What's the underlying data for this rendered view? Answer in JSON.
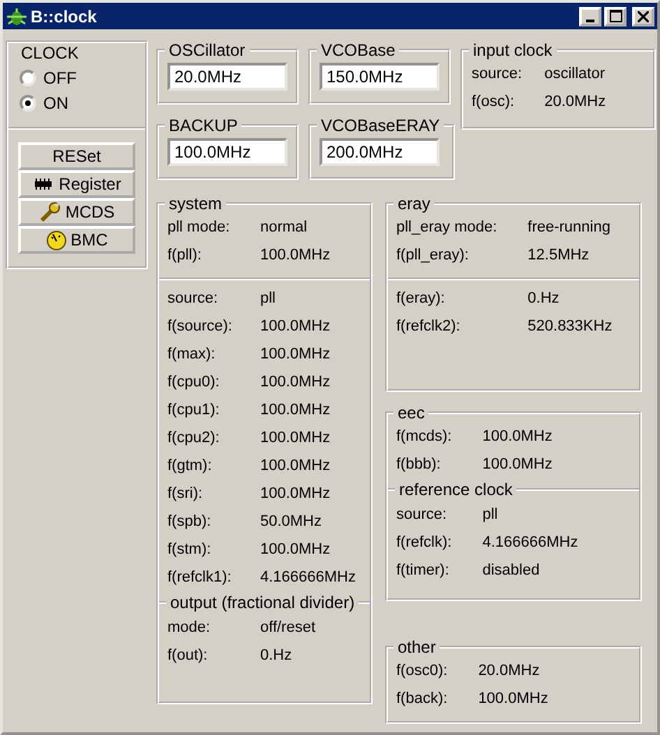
{
  "window": {
    "title": "B::clock"
  },
  "clock": {
    "title": "CLOCK",
    "options": [
      {
        "label": "OFF",
        "selected": false
      },
      {
        "label": "ON",
        "selected": true
      }
    ]
  },
  "buttons": [
    {
      "label": "RESet",
      "kind": "plain"
    },
    {
      "label": "Register",
      "kind": "chip"
    },
    {
      "label": "MCDS",
      "kind": "wrench"
    },
    {
      "label": "BMC",
      "kind": "gauge"
    }
  ],
  "fields": [
    {
      "label": "OSCillator",
      "value": "20.0MHz"
    },
    {
      "label": "VCOBase",
      "value": "150.0MHz"
    },
    {
      "label": "BACKUP",
      "value": "100.0MHz"
    },
    {
      "label": "VCOBaseERAY",
      "value": "200.0MHz"
    }
  ],
  "input_clock": {
    "title": "input clock",
    "sections": [
      {
        "rows": [
          [
            "source:",
            "oscillator"
          ],
          [
            "f(osc):",
            "20.0MHz"
          ]
        ]
      }
    ]
  },
  "system": {
    "title": "system",
    "sections": [
      {
        "rows": [
          [
            "pll mode:",
            "normal"
          ],
          [
            "f(pll):",
            "100.0MHz"
          ]
        ]
      },
      {
        "rows": [
          [
            "source:",
            "pll"
          ],
          [
            "f(source):",
            "100.0MHz"
          ],
          [
            "f(max):",
            "100.0MHz"
          ],
          [
            "f(cpu0):",
            "100.0MHz"
          ],
          [
            "f(cpu1):",
            "100.0MHz"
          ],
          [
            "f(cpu2):",
            "100.0MHz"
          ],
          [
            "f(gtm):",
            "100.0MHz"
          ],
          [
            "f(sri):",
            "100.0MHz"
          ],
          [
            "f(spb):",
            "50.0MHz"
          ],
          [
            "f(stm):",
            "100.0MHz"
          ],
          [
            "f(refclk1):",
            "4.166666MHz"
          ]
        ]
      },
      {
        "title": "output (fractional divider)",
        "rows": [
          [
            "mode:",
            "off/reset"
          ],
          [
            "f(out):",
            "0.Hz"
          ]
        ]
      }
    ]
  },
  "eray": {
    "title": "eray",
    "sections": [
      {
        "rows": [
          [
            "pll_eray mode:",
            "free-running"
          ],
          [
            "f(pll_eray):",
            "12.5MHz"
          ]
        ]
      },
      {
        "rows": [
          [
            "f(eray):",
            "0.Hz"
          ],
          [
            "f(refclk2):",
            "520.833KHz"
          ]
        ]
      }
    ]
  },
  "eec": {
    "title": "eec",
    "sections": [
      {
        "rows": [
          [
            "f(mcds):",
            "100.0MHz"
          ],
          [
            "f(bbb):",
            "100.0MHz"
          ]
        ]
      },
      {
        "title": "reference clock",
        "rows": [
          [
            "source:",
            "pll"
          ],
          [
            "f(refclk):",
            "4.166666MHz"
          ],
          [
            "f(timer):",
            "disabled"
          ]
        ]
      }
    ]
  },
  "other": {
    "title": "other",
    "sections": [
      {
        "rows": [
          [
            "f(osc0):",
            "20.0MHz"
          ],
          [
            "f(back):",
            "100.0MHz"
          ]
        ]
      }
    ]
  }
}
